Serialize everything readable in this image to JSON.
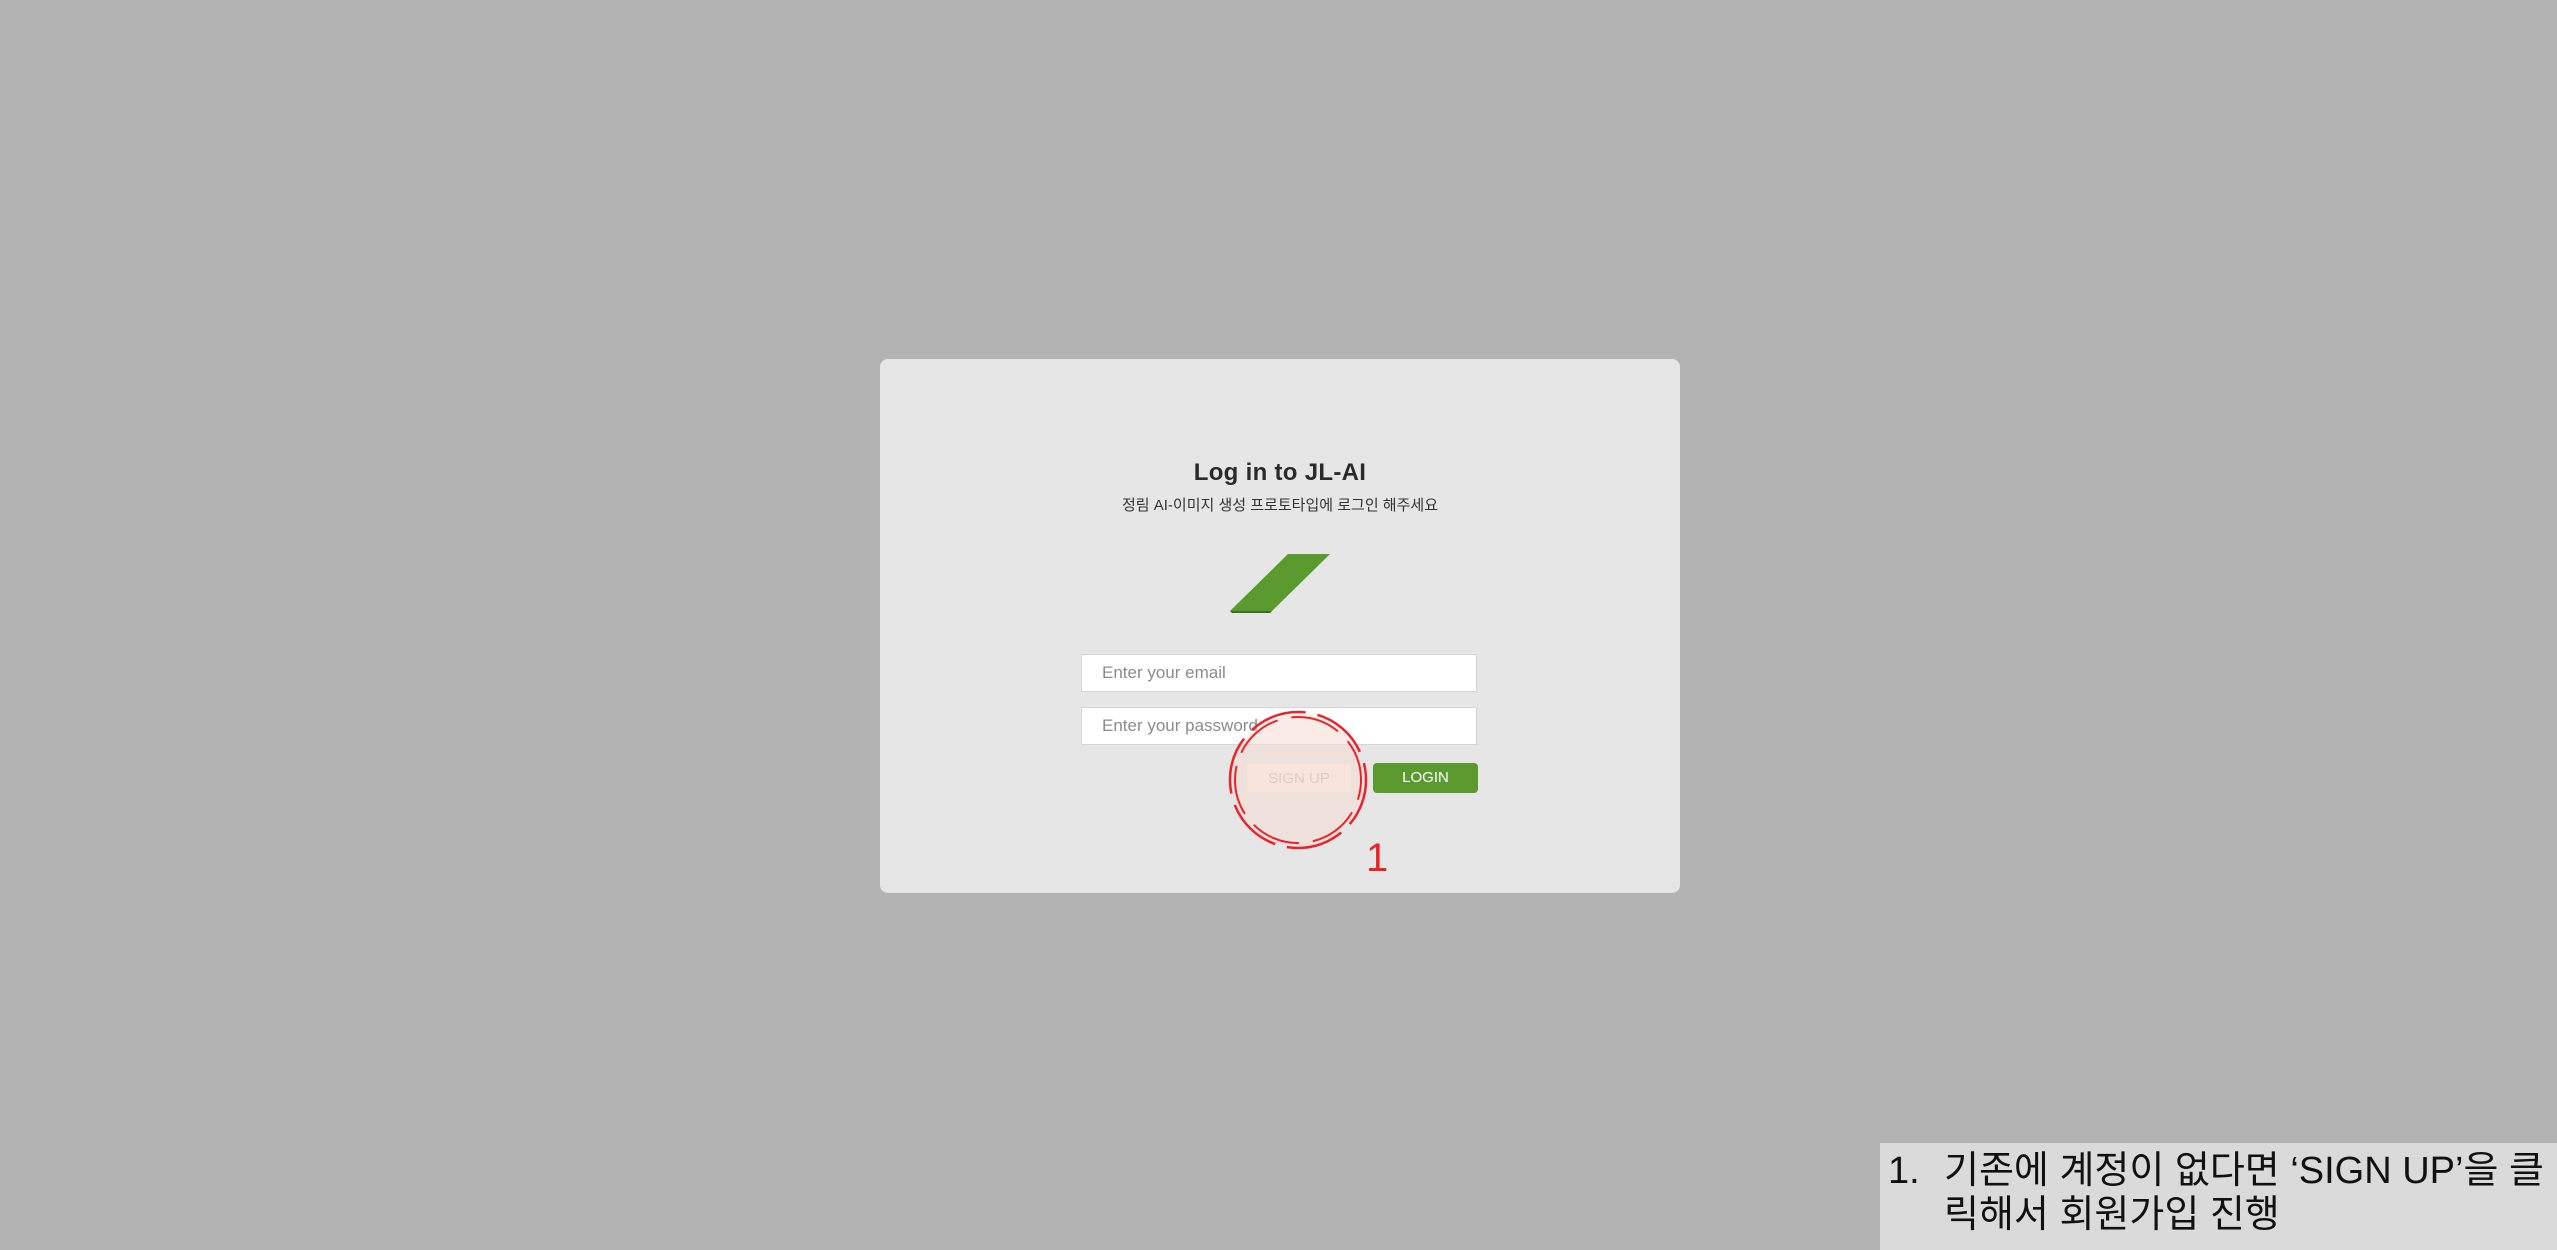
{
  "login": {
    "title": "Log in to JL-AI",
    "subtitle": "정림 AI-이미지 생성 프로토타입에 로그인 해주세요",
    "email_placeholder": "Enter your email",
    "password_placeholder": "Enter your password",
    "signup_label": "SIGN UP",
    "login_label": "LOGIN"
  },
  "annotation": {
    "marker_number": "1",
    "instruction_number": "1.",
    "instruction_text": "기존에 계정이 없다면 ‘SIGN UP’을 클릭해서 회원가입 진행"
  },
  "icons": {
    "logo": "parallelogram-logo-icon",
    "highlight": "dashed-circle-highlight"
  },
  "colors": {
    "background": "#b3b3b3",
    "card": "#e6e6e6",
    "brand_green": "#5a9a2e",
    "highlight_red": "#e8242a",
    "signup_fill": "#fbefe6"
  }
}
